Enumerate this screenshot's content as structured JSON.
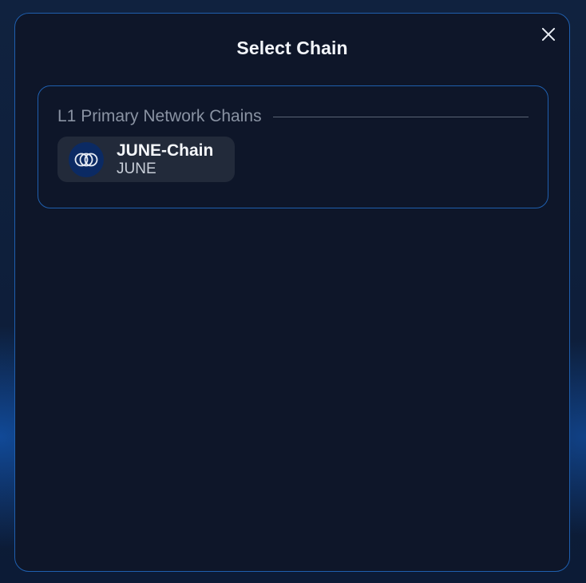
{
  "modal": {
    "title": "Select Chain",
    "close_icon": "close-icon"
  },
  "section": {
    "label": "L1 Primary Network Chains"
  },
  "chains": [
    {
      "name": "JUNE-Chain",
      "symbol": "JUNE",
      "icon": "june-chain-logo-icon"
    }
  ],
  "colors": {
    "modal_background": "#0e1629",
    "border_accent": "#1f5fae",
    "item_background": "#222a3a",
    "logo_background": "#0b2a63",
    "muted_text": "#8a93a3"
  }
}
